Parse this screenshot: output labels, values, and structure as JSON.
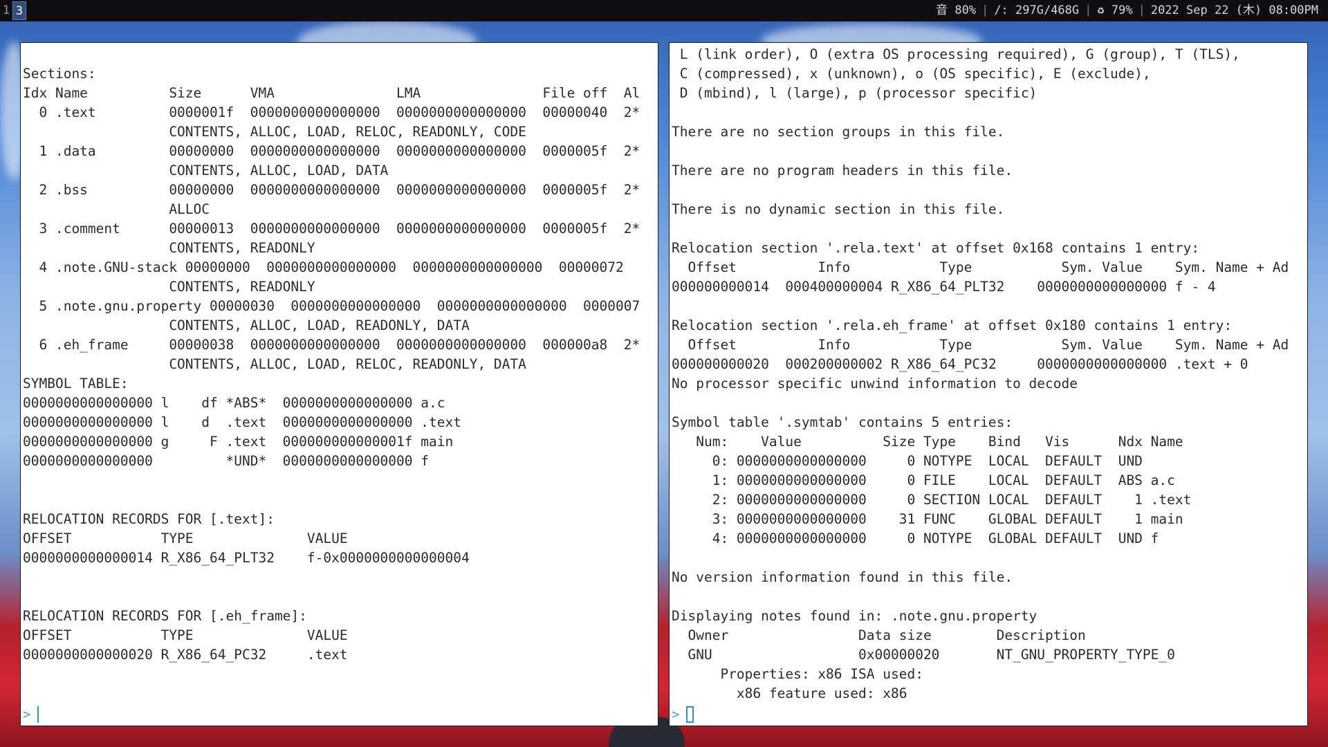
{
  "topbar": {
    "workspaces": [
      "1",
      "3"
    ],
    "volume": "音 80%",
    "disk": "/: 297G/468G",
    "battery": "♻ 79%",
    "datetime": "2022 Sep 22 (木) 08:00PM"
  },
  "left_terminal": {
    "lines": [
      "Sections:",
      "Idx Name          Size      VMA               LMA               File off  Al",
      "  0 .text         0000001f  0000000000000000  0000000000000000  00000040  2*",
      "                  CONTENTS, ALLOC, LOAD, RELOC, READONLY, CODE",
      "  1 .data         00000000  0000000000000000  0000000000000000  0000005f  2*",
      "                  CONTENTS, ALLOC, LOAD, DATA",
      "  2 .bss          00000000  0000000000000000  0000000000000000  0000005f  2*",
      "                  ALLOC",
      "  3 .comment      00000013  0000000000000000  0000000000000000  0000005f  2*",
      "                  CONTENTS, READONLY",
      "  4 .note.GNU-stack 00000000  0000000000000000  0000000000000000  00000072",
      "                  CONTENTS, READONLY",
      "  5 .note.gnu.property 00000030  0000000000000000  0000000000000000  0000007",
      "                  CONTENTS, ALLOC, LOAD, READONLY, DATA",
      "  6 .eh_frame     00000038  0000000000000000  0000000000000000  000000a8  2*",
      "                  CONTENTS, ALLOC, LOAD, RELOC, READONLY, DATA",
      "SYMBOL TABLE:",
      "0000000000000000 l    df *ABS*  0000000000000000 a.c",
      "0000000000000000 l    d  .text  0000000000000000 .text",
      "0000000000000000 g     F .text  000000000000001f main",
      "0000000000000000         *UND*  0000000000000000 f",
      "",
      "",
      "RELOCATION RECORDS FOR [.text]:",
      "OFFSET           TYPE              VALUE",
      "0000000000000014 R_X86_64_PLT32    f-0x0000000000000004",
      "",
      "",
      "RELOCATION RECORDS FOR [.eh_frame]:",
      "OFFSET           TYPE              VALUE",
      "0000000000000020 R_X86_64_PC32     .text"
    ],
    "prompt": ">"
  },
  "right_terminal": {
    "lines": [
      " L (link order), O (extra OS processing required), G (group), T (TLS),",
      " C (compressed), x (unknown), o (OS specific), E (exclude),",
      " D (mbind), l (large), p (processor specific)",
      "",
      "There are no section groups in this file.",
      "",
      "There are no program headers in this file.",
      "",
      "There is no dynamic section in this file.",
      "",
      "Relocation section '.rela.text' at offset 0x168 contains 1 entry:",
      "  Offset          Info           Type           Sym. Value    Sym. Name + Ad",
      "000000000014  000400000004 R_X86_64_PLT32    0000000000000000 f - 4",
      "",
      "Relocation section '.rela.eh_frame' at offset 0x180 contains 1 entry:",
      "  Offset          Info           Type           Sym. Value    Sym. Name + Ad",
      "000000000020  000200000002 R_X86_64_PC32     0000000000000000 .text + 0",
      "No processor specific unwind information to decode",
      "",
      "Symbol table '.symtab' contains 5 entries:",
      "   Num:    Value          Size Type    Bind   Vis      Ndx Name",
      "     0: 0000000000000000     0 NOTYPE  LOCAL  DEFAULT  UND",
      "     1: 0000000000000000     0 FILE    LOCAL  DEFAULT  ABS a.c",
      "     2: 0000000000000000     0 SECTION LOCAL  DEFAULT    1 .text",
      "     3: 0000000000000000    31 FUNC    GLOBAL DEFAULT    1 main",
      "     4: 0000000000000000     0 NOTYPE  GLOBAL DEFAULT  UND f",
      "",
      "No version information found in this file.",
      "",
      "Displaying notes found in: .note.gnu.property",
      "  Owner                Data size        Description",
      "  GNU                  0x00000020       NT_GNU_PROPERTY_TYPE_0",
      "      Properties: x86 ISA used:",
      "        x86 feature used: x86"
    ],
    "prompt": ">"
  }
}
